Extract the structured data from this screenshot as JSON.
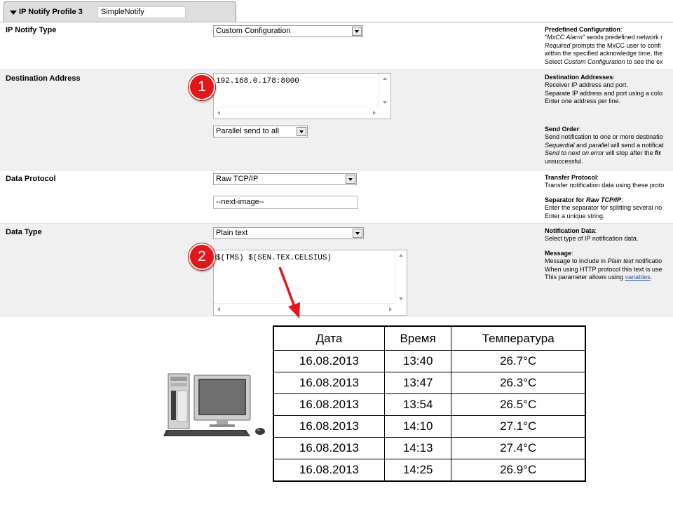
{
  "tab": {
    "title": "IP Notify Profile 3",
    "profile_name": "SimpleNotify"
  },
  "rows": {
    "notify_type": {
      "label": "IP Notify Type",
      "select_value": "Custom Configuration",
      "help": {
        "heading": "Predefined Configuration",
        "line1_italic": "\"MxCC Alarm\"",
        "line1_rest": " sends predefined network r",
        "line2_italic": "Required",
        "line2_rest": " prompts the MxCC user to confi",
        "line3": "within the specified acknowledge time, the",
        "line4_a": "Select ",
        "line4_italic": "Custom Configuration",
        "line4_b": " to see the ex"
      }
    },
    "destination": {
      "label": "Destination Address",
      "address_value": "192.168.0.178:8000",
      "send_order_value": "Parallel send to all",
      "help_address": {
        "heading": "Destination Addresses",
        "line1": "Receiver IP address and port.",
        "line2": "Separate IP address and port using a colo",
        "line3": "Enter one address per line."
      },
      "help_order": {
        "heading": "Send Order",
        "line1": "Send notification to one or more destinatio",
        "line2_italic_a": "Sequential",
        "line2_mid": " and ",
        "line2_italic_b": "parallel",
        "line2_rest": " will send a notificat",
        "line3_italic": "Send to next on error",
        "line3_rest": " will stop after the ",
        "line3_bold": "fir",
        "line4": "unsuccessful."
      }
    },
    "protocol": {
      "label": "Data Protocol",
      "select_value": "Raw TCP/IP",
      "separator_value": "--next-image--",
      "help_protocol": {
        "heading": "Transfer Protocol",
        "line1": "Transfer notification data using these proto"
      },
      "help_separator": {
        "heading_a": "Separator for ",
        "heading_italic": "Raw TCP/IP",
        "line1": "Enter the separator for splitting several no",
        "line2": "Enter a unique string."
      }
    },
    "data_type": {
      "label": "Data Type",
      "select_value": "Plain text",
      "message_value": "$(TMS) $(SEN.TEX.CELSIUS)",
      "help_data": {
        "heading": "Notification Data",
        "line1": "Select type of IP notification data."
      },
      "help_message": {
        "heading": "Message",
        "line1_a": "Message to include in ",
        "line1_italic": "Plain text",
        "line1_b": " notificatio",
        "line2": "When using HTTP protocol this text is use",
        "line3_a": "This parameter allows using ",
        "line3_link": "variables",
        "line3_b": "."
      }
    }
  },
  "badges": [
    "1",
    "2"
  ],
  "table": {
    "headers": [
      "Дата",
      "Время",
      "Температура"
    ],
    "rows": [
      [
        "16.08.2013",
        "13:40",
        "26.7°C"
      ],
      [
        "16.08.2013",
        "13:47",
        "26.3°C"
      ],
      [
        "16.08.2013",
        "13:54",
        "26.5°C"
      ],
      [
        "16.08.2013",
        "14:10",
        "27.1°C"
      ],
      [
        "16.08.2013",
        "14:13",
        "27.4°C"
      ],
      [
        "16.08.2013",
        "14:25",
        "26.9°C"
      ]
    ]
  },
  "colors": {
    "badge_red": "#e3161a",
    "arrow_red": "#e3161a",
    "row_alt": "#f0f0f0",
    "tab_bg": "#dedede",
    "link": "#2a55a8"
  },
  "icons": {
    "tab_toggle": "triangle-down-icon",
    "computer": "desktop-computer-icon",
    "arrow": "red-arrow-icon"
  }
}
